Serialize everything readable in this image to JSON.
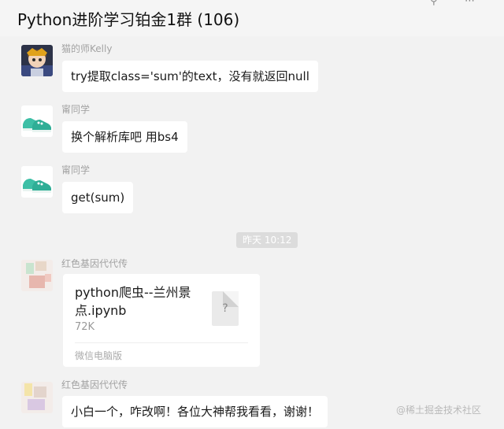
{
  "header": {
    "title": "Python进阶学习铂金1群 (106)",
    "pin_icon": "pin-icon",
    "more_icon": "more-icon"
  },
  "messages": [
    {
      "sender": "猫的师Kelly",
      "text": "try提取class='sum'的text，没有就返回null",
      "avatar": "cartoon-avatar"
    },
    {
      "sender": "甯同学",
      "text": "换个解析库吧 用bs4",
      "avatar": "shoe-avatar"
    },
    {
      "sender": "甯同学",
      "text": "get(sum)",
      "avatar": "shoe-avatar"
    }
  ],
  "timestamp": "昨天 10:12",
  "file_message": {
    "sender": "红色基因代代传",
    "file_name": "python爬虫--兰州景点.ipynb",
    "file_size": "72K",
    "source": "微信电脑版",
    "icon": "unknown-file-icon"
  },
  "last_message": {
    "sender": "红色基因代代传",
    "text": "小白一个，咋改啊！各位大神帮我看看，谢谢！"
  },
  "watermark": "@稀土掘金技术社区",
  "colors": {
    "background": "#f2f2f2",
    "bubble": "#ffffff",
    "sender_text": "#a3a3a3",
    "shoe_teal": "#3dbfa6"
  }
}
